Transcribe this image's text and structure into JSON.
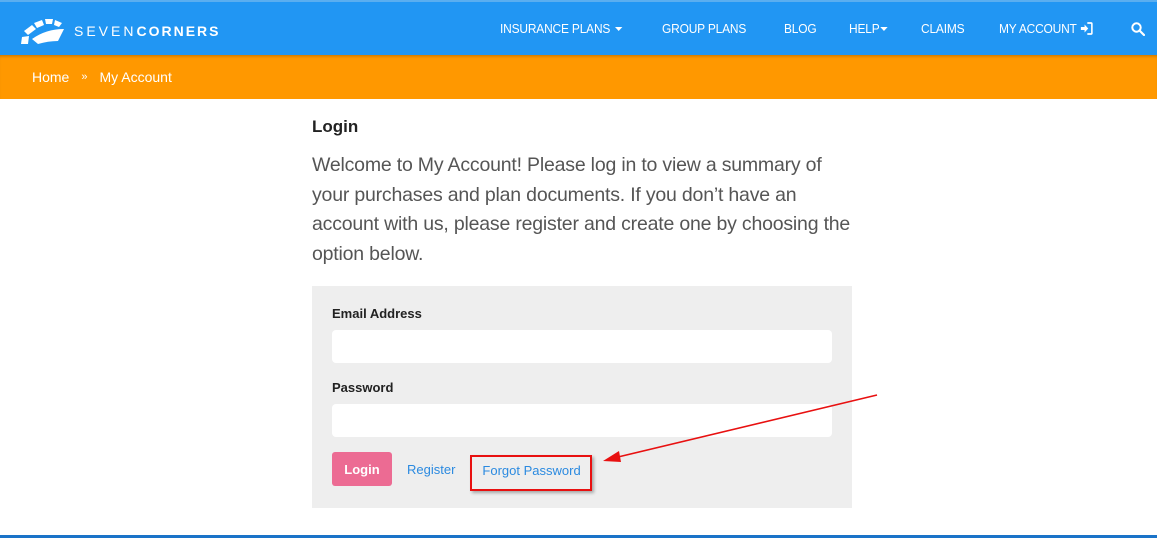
{
  "header": {
    "logo": {
      "text_light": "SEVEN",
      "text_bold": "CORNERS",
      "icon": "seven-corners-logo-icon"
    },
    "nav": [
      {
        "label": "INSURANCE PLANS",
        "has_dropdown": true
      },
      {
        "label": "GROUP PLANS",
        "has_dropdown": false
      },
      {
        "label": "BLOG",
        "has_dropdown": false
      },
      {
        "label": "HELP",
        "has_dropdown": true
      },
      {
        "label": "CLAIMS",
        "has_dropdown": false
      },
      {
        "label": "MY ACCOUNT",
        "icon": "sign-in-icon"
      }
    ],
    "search_icon": "search-icon",
    "colors": {
      "nav_bg": "#2196f3",
      "breadcrumb_bg": "#ff9800"
    }
  },
  "breadcrumb": {
    "items": [
      "Home",
      "My Account"
    ],
    "separator": "»"
  },
  "main": {
    "title": "Login",
    "welcome": "Welcome to My Account! Please log in to view a summary of your purchases and plan documents. If you don’t have an account with us, please register and create one by choosing the option below."
  },
  "login_form": {
    "email_label": "Email Address",
    "email_value": "",
    "password_label": "Password",
    "password_value": "",
    "login_button": "Login",
    "register_link": "Register",
    "forgot_link": "Forgot Password",
    "colors": {
      "button": "#ec6b93",
      "link": "#2b8ae0",
      "highlight": "#e81010"
    }
  }
}
